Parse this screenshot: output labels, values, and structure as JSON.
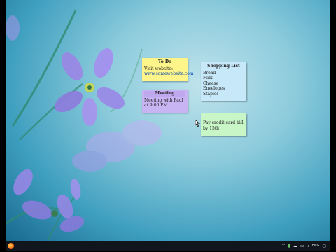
{
  "notes": {
    "todo": {
      "title": "To Do",
      "line1": "Visit website:",
      "link": "www.somewebsite.com"
    },
    "meeting": {
      "title": "Meeting",
      "body": "Meeting with Paul at 9:00 PM"
    },
    "shopping": {
      "title": "Shopping List",
      "items": [
        "Bread",
        "Milk",
        "Cheese",
        "Envelopes",
        "Staples"
      ]
    },
    "bill": {
      "body": "Pay credit card bill by 15th"
    }
  },
  "taskbar": {
    "tray": {
      "language": "ENG"
    }
  },
  "icons": [
    "firefox-icon",
    "chevron-up-icon",
    "battery-icon",
    "cloud-icon",
    "network-icon",
    "volume-icon",
    "notification-icon"
  ]
}
